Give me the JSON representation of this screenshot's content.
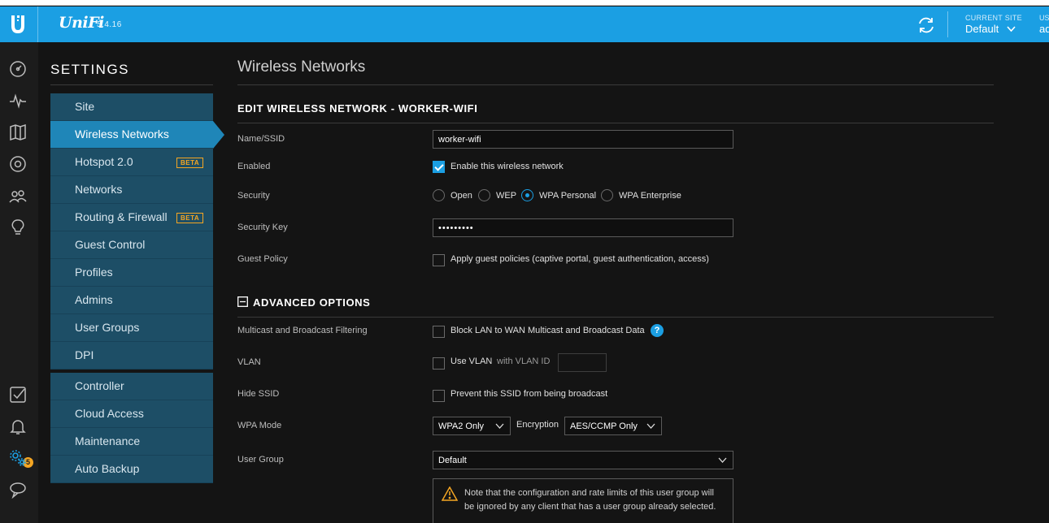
{
  "app": {
    "logo_text": "UniFi",
    "version": "5.4.16"
  },
  "topbar": {
    "site_label": "CURRENT SITE",
    "site_value": "Default",
    "user_label": "US",
    "user_value": "ad"
  },
  "settings": {
    "title": "SETTINGS",
    "menu": [
      {
        "label": "Site"
      },
      {
        "label": "Wireless Networks",
        "active": true
      },
      {
        "label": "Hotspot 2.0",
        "badge": "BETA"
      },
      {
        "label": "Networks"
      },
      {
        "label": "Routing & Firewall",
        "badge": "BETA"
      },
      {
        "label": "Guest Control"
      },
      {
        "label": "Profiles"
      },
      {
        "label": "Admins"
      },
      {
        "label": "User Groups"
      },
      {
        "label": "DPI"
      }
    ],
    "menu2": [
      {
        "label": "Controller"
      },
      {
        "label": "Cloud Access"
      },
      {
        "label": "Maintenance"
      },
      {
        "label": "Auto Backup"
      }
    ]
  },
  "nav": {
    "notification_count": "5"
  },
  "page": {
    "title": "Wireless Networks",
    "section_title": "EDIT WIRELESS NETWORK - WORKER-WIFI",
    "fields": {
      "ssid_label": "Name/SSID",
      "ssid_value": "worker-wifi",
      "enabled_label": "Enabled",
      "enabled_text": "Enable this wireless network",
      "security_label": "Security",
      "security_options": [
        "Open",
        "WEP",
        "WPA Personal",
        "WPA Enterprise"
      ],
      "security_selected": "WPA Personal",
      "key_label": "Security Key",
      "key_value": "•••••••••",
      "guest_label": "Guest Policy",
      "guest_text": "Apply guest policies (captive portal, guest authentication, access)"
    },
    "advanced": {
      "title": "ADVANCED OPTIONS",
      "toggle_icon": "minus-square-icon",
      "multicast_label": "Multicast and Broadcast Filtering",
      "multicast_text": "Block LAN to WAN Multicast and Broadcast Data",
      "help": "?",
      "vlan_label": "VLAN",
      "vlan_text": "Use VLAN",
      "vlan_id_text": "with VLAN ID",
      "hide_label": "Hide SSID",
      "hide_text": "Prevent this SSID from being broadcast",
      "wpa_mode_label": "WPA Mode",
      "wpa_mode_value": "WPA2 Only",
      "encryption_label": "Encryption",
      "encryption_value": "AES/CCMP Only",
      "user_group_label": "User Group",
      "user_group_value": "Default",
      "note": "Note that the configuration and rate limits of this user group will be ignored by any client that has a user group already selected."
    }
  },
  "colors": {
    "accent": "#1b9fe3",
    "menu_bg": "#1d4e66",
    "menu_active": "#1f86b8",
    "beta": "#f5a623"
  }
}
